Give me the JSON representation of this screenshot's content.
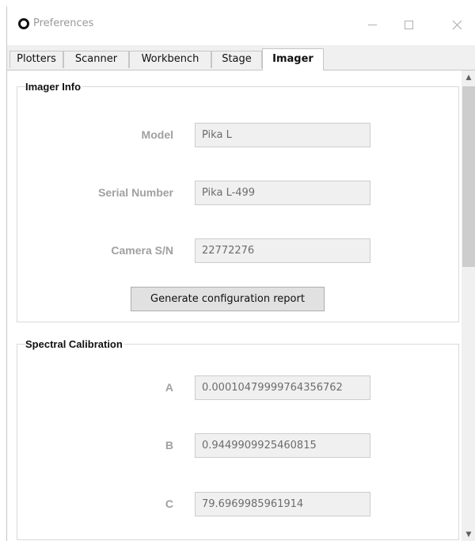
{
  "window": {
    "title": "Preferences"
  },
  "tabs": [
    {
      "label": "Plotters"
    },
    {
      "label": "Scanner"
    },
    {
      "label": "Workbench"
    },
    {
      "label": "Stage"
    },
    {
      "label": "Imager"
    }
  ],
  "active_tab": "Imager",
  "imager_info": {
    "title": "Imager Info",
    "model_label": "Model",
    "model_value": "Pika L",
    "serial_label": "Serial Number",
    "serial_value": "Pika L-499",
    "camera_label": "Camera S/N",
    "camera_value": "22772276",
    "report_button": "Generate configuration report"
  },
  "spectral_calibration": {
    "title": "Spectral Calibration",
    "a_label": "A",
    "a_value": "0.00010479999764356762",
    "b_label": "B",
    "b_value": "0.9449909925460815",
    "c_label": "C",
    "c_value": "79.6969985961914"
  },
  "icons": {
    "app": "app-ring-icon",
    "minimize": "minimize-icon",
    "maximize": "maximize-icon",
    "close": "close-icon",
    "scroll_up": "scroll-up-arrow-icon",
    "scroll_down": "scroll-down-arrow-icon"
  }
}
